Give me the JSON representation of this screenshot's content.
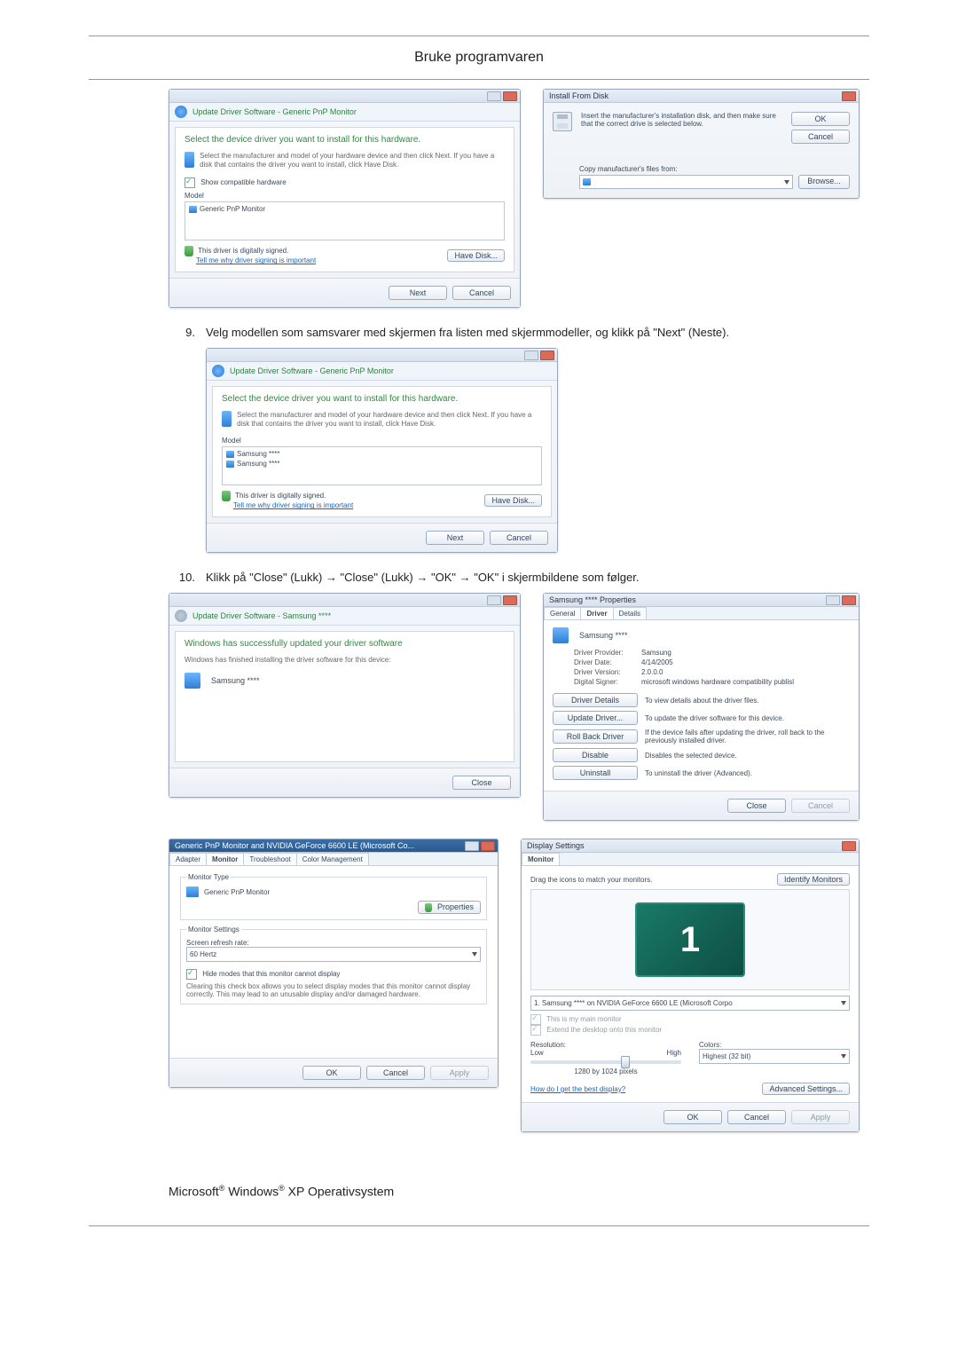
{
  "page_header": "Bruke programvaren",
  "step9": {
    "num": "9.",
    "text": "Velg modellen som samsvarer med skjermen fra listen med skjermmodeller, og klikk på \"Next\" (Neste)."
  },
  "step10": {
    "num": "10.",
    "text": "Klikk på \"Close\" (Lukk) → \"Close\" (Lukk) → \"OK\" → \"OK\" i skjermbildene som følger."
  },
  "update_driver": {
    "crumb": "Update Driver Software - Generic PnP Monitor",
    "heading": "Select the device driver you want to install for this hardware.",
    "sub": "Select the manufacturer and model of your hardware device and then click Next. If you have a disk that contains the driver you want to install, click Have Disk.",
    "compat_label": "Show compatible hardware",
    "model_header": "Model",
    "model_item": "Generic PnP Monitor",
    "signed": "This driver is digitally signed.",
    "why_link": "Tell me why driver signing is important",
    "have_disk": "Have Disk...",
    "next": "Next",
    "cancel": "Cancel"
  },
  "install_disk": {
    "title": "Install From Disk",
    "msg": "Insert the manufacturer's installation disk, and then make sure that the correct drive is selected below.",
    "ok": "OK",
    "cancel": "Cancel",
    "copy_label": "Copy manufacturer's files from:",
    "browse": "Browse..."
  },
  "update_driver2": {
    "crumb": "Update Driver Software - Generic PnP Monitor",
    "heading": "Select the device driver you want to install for this hardware.",
    "sub": "Select the manufacturer and model of your hardware device and then click Next. If you have a disk that contains the driver you want to install, click Have Disk.",
    "model_header": "Model",
    "item1": "Samsung ****",
    "item2": "Samsung ****",
    "signed": "This driver is digitally signed.",
    "why_link": "Tell me why driver signing is important",
    "have_disk": "Have Disk...",
    "next": "Next",
    "cancel": "Cancel"
  },
  "success": {
    "crumb": "Update Driver Software - Samsung ****",
    "heading": "Windows has successfully updated your driver software",
    "sub": "Windows has finished installing the driver software for this device:",
    "device": "Samsung ****",
    "close": "Close"
  },
  "props": {
    "title": "Samsung **** Properties",
    "tab_general": "General",
    "tab_driver": "Driver",
    "tab_details": "Details",
    "device": "Samsung ****",
    "provider_l": "Driver Provider:",
    "provider_v": "Samsung",
    "date_l": "Driver Date:",
    "date_v": "4/14/2005",
    "ver_l": "Driver Version:",
    "ver_v": "2.0.0.0",
    "signer_l": "Digital Signer:",
    "signer_v": "microsoft windows hardware compatibility publisl",
    "btn_details": "Driver Details",
    "det_desc": "To view details about the driver files.",
    "btn_update": "Update Driver...",
    "upd_desc": "To update the driver software for this device.",
    "btn_rollback": "Roll Back Driver",
    "rb_desc": "If the device fails after updating the driver, roll back to the previously installed driver.",
    "btn_disable": "Disable",
    "dis_desc": "Disables the selected device.",
    "btn_uninstall": "Uninstall",
    "un_desc": "To uninstall the driver (Advanced).",
    "close": "Close",
    "cancel": "Cancel"
  },
  "monprops": {
    "title": "Generic PnP Monitor and NVIDIA GeForce 6600 LE (Microsoft Co...",
    "tab_adapter": "Adapter",
    "tab_monitor": "Monitor",
    "tab_trouble": "Troubleshoot",
    "tab_color": "Color Management",
    "type_group": "Monitor Type",
    "type_name": "Generic PnP Monitor",
    "properties_btn": "Properties",
    "settings_group": "Monitor Settings",
    "refresh_label": "Screen refresh rate:",
    "refresh_value": "60 Hertz",
    "hide_modes": "Hide modes that this monitor cannot display",
    "hide_desc": "Clearing this check box allows you to select display modes that this monitor cannot display correctly. This may lead to an unusable display and/or damaged hardware.",
    "ok": "OK",
    "cancel": "Cancel",
    "apply": "Apply"
  },
  "display": {
    "title": "Display Settings",
    "tab_monitor": "Monitor",
    "drag_text": "Drag the icons to match your monitors.",
    "identify": "Identify Monitors",
    "number": "1",
    "select_value": "1. Samsung **** on NVIDIA GeForce 6600 LE (Microsoft Corpo",
    "main_chk": "This is my main monitor",
    "extend_chk": "Extend the desktop onto this monitor",
    "res_label": "Resolution:",
    "low": "Low",
    "high": "High",
    "res_value": "1280 by 1024 pixels",
    "colors_label": "Colors:",
    "colors_value": "Highest (32 bit)",
    "best_link": "How do I get the best display?",
    "adv": "Advanced Settings...",
    "ok": "OK",
    "cancel": "Cancel",
    "apply": "Apply"
  },
  "footer": {
    "ms": "Microsoft",
    "win": "Windows",
    "rest": "XP Operativsystem",
    "reg": "®"
  }
}
